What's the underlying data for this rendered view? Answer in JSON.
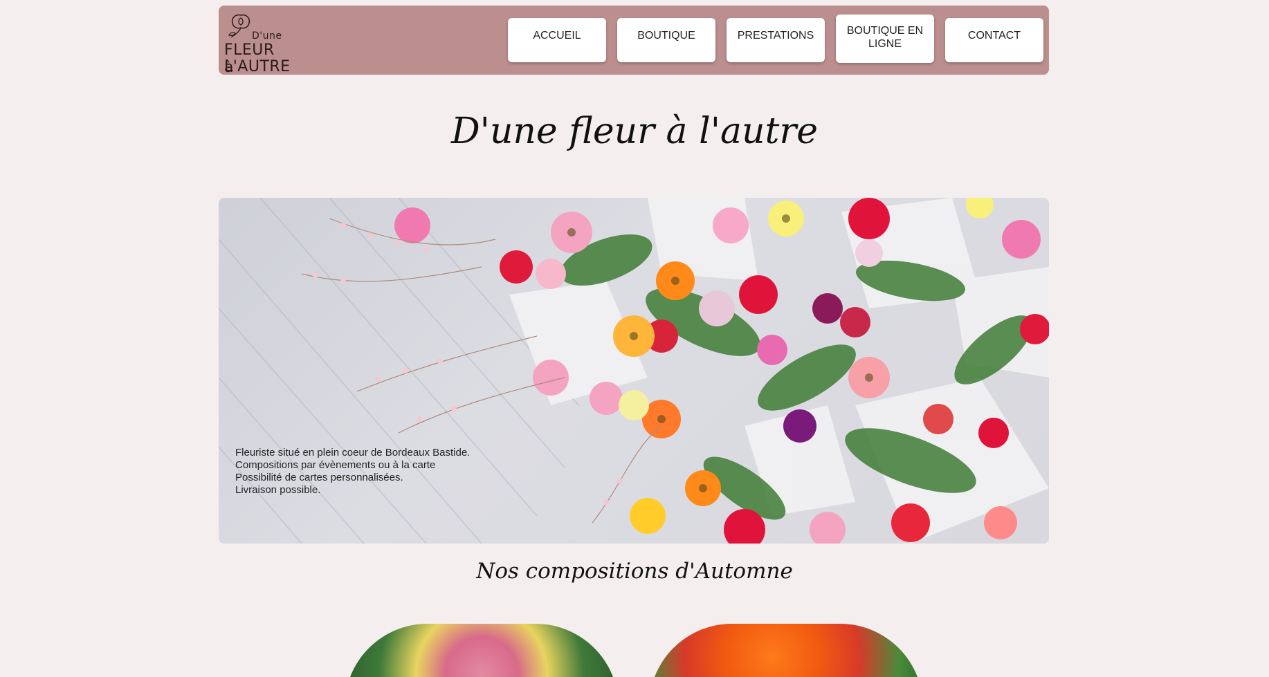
{
  "logo": {
    "line1": "D'une",
    "line2": "FLEUR à",
    "line3": "L'AUTRE"
  },
  "nav": {
    "items": [
      {
        "label": "ACCUEIL"
      },
      {
        "label": "BOUTIQUE"
      },
      {
        "label": "PRESTATIONS"
      },
      {
        "label": "BOUTIQUE EN LIGNE"
      },
      {
        "label": "CONTACT"
      }
    ]
  },
  "main": {
    "title": "D'une fleur à l'autre",
    "hero_lines": [
      "Fleuriste situé en plein coeur de Bordeaux Bastide.",
      "Compositions par évènements ou à la carte",
      "Possibilité de cartes personnalisées.",
      "Livraison possible."
    ],
    "section_title": "Nos compositions d'Automne"
  },
  "colors": {
    "header_bg": "#bc8f8f",
    "page_bg": "#f5eeee",
    "button_bg": "#ffffff"
  }
}
